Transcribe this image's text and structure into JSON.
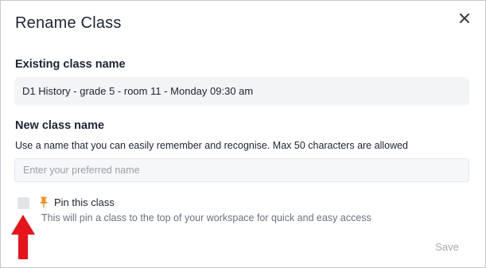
{
  "dialog": {
    "title": "Rename Class",
    "close_icon": "close-icon"
  },
  "existing": {
    "label": "Existing class name",
    "value": "D1 History - grade 5 - room 11 - Monday 09:30 am"
  },
  "new_name": {
    "label": "New class name",
    "helper": "Use a name that you can easily remember and recognise. Max 50 characters are allowed",
    "placeholder": "Enter your preferred name",
    "value": ""
  },
  "pin": {
    "checked": false,
    "icon": "pin-icon",
    "icon_color": "#f0932b",
    "label": "Pin this class",
    "description": "This will pin a class to the top of your workspace for quick and easy access"
  },
  "annotation": {
    "icon": "red-arrow-up-icon",
    "color": "#e8141b"
  },
  "footer": {
    "save_label": "Save"
  }
}
